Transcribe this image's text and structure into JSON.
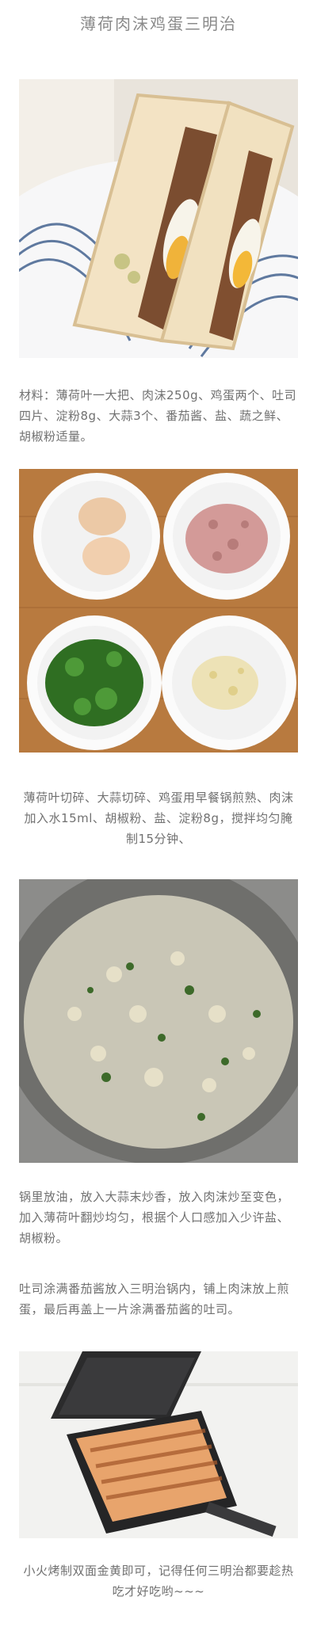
{
  "title": "薄荷肉沫鸡蛋三明治",
  "paragraphs": {
    "p1": "材料：薄荷叶一大把、肉沫250g、鸡蛋两个、吐司四片、淀粉8g、大蒜3个、番茄酱、盐、蔬之鲜、胡椒粉适量。",
    "p2": "薄荷叶切碎、大蒜切碎、鸡蛋用早餐锅煎熟、肉沫加入水15ml、胡椒粉、盐、淀粉8g，搅拌均匀腌制15分钟、",
    "p3": "锅里放油，放入大蒜末炒香，放入肉沫炒至变色，加入薄荷叶翻炒均匀，根据个人口感加入少许盐、胡椒粉。",
    "p4": "吐司涂满番茄酱放入三明治锅内，铺上肉沫放上煎蛋，最后再盖上一片涂满番茄酱的吐司。",
    "p5": "小火烤制双面金黄即可，记得任何三明治都要趁热吃才好吃哟~~~"
  },
  "colors": {
    "bread": "#f1e2c8",
    "crust": "#d9b98a",
    "yolk": "#f0b33a",
    "meat": "#8a5a3a",
    "wood": "#b97a3e",
    "mint": "#3c7a2a",
    "pan": "#8a8a88"
  }
}
